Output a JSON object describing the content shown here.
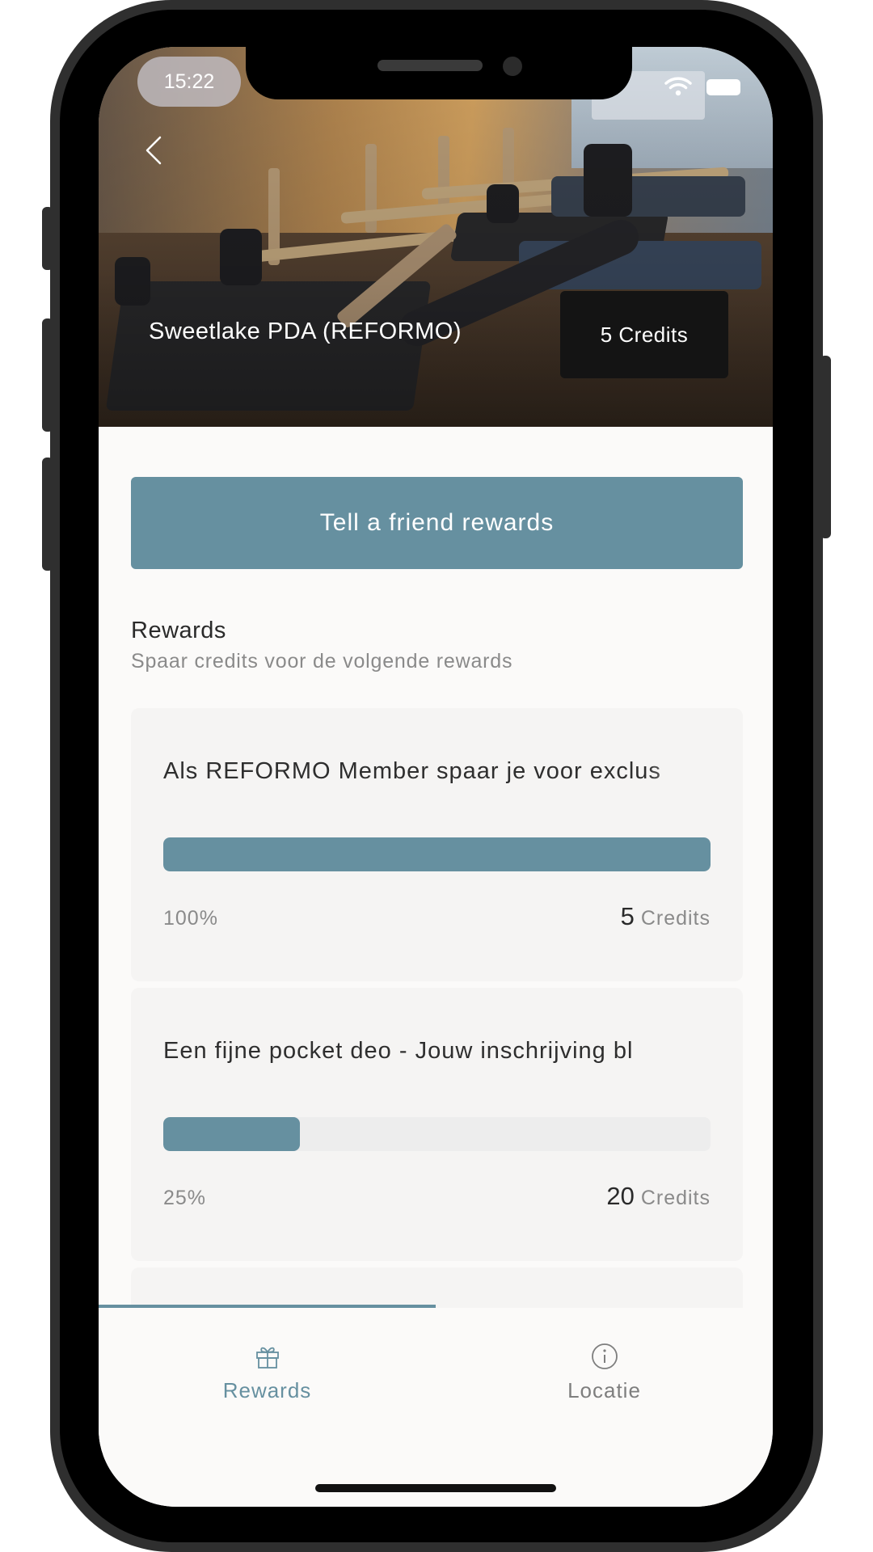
{
  "status_bar": {
    "time": "15:22"
  },
  "hero": {
    "title": "Sweetlake PDA (REFORMO)",
    "credits_badge": "5 Credits"
  },
  "cta": {
    "label": "Tell a friend rewards"
  },
  "rewards_section": {
    "title": "Rewards",
    "subtitle": "Spaar credits voor de volgende rewards",
    "items": [
      {
        "title": "Als REFORMO Member spaar je voor exclus",
        "progress_percent": 100,
        "progress_label": "100%",
        "credits_value": "5",
        "credits_label": "Credits"
      },
      {
        "title": "Een fijne pocket deo - Jouw inschrijving bl",
        "progress_percent": 25,
        "progress_label": "25%",
        "credits_value": "20",
        "credits_label": "Credits"
      }
    ]
  },
  "tab_bar": {
    "tabs": [
      {
        "label": "Rewards",
        "icon": "gift-icon",
        "active": true
      },
      {
        "label": "Locatie",
        "icon": "info-icon",
        "active": false
      }
    ]
  },
  "colors": {
    "accent": "#6690a0",
    "badge_bg": "#141414",
    "card_bg": "#f5f4f3",
    "screen_bg": "#fbfaf9"
  }
}
